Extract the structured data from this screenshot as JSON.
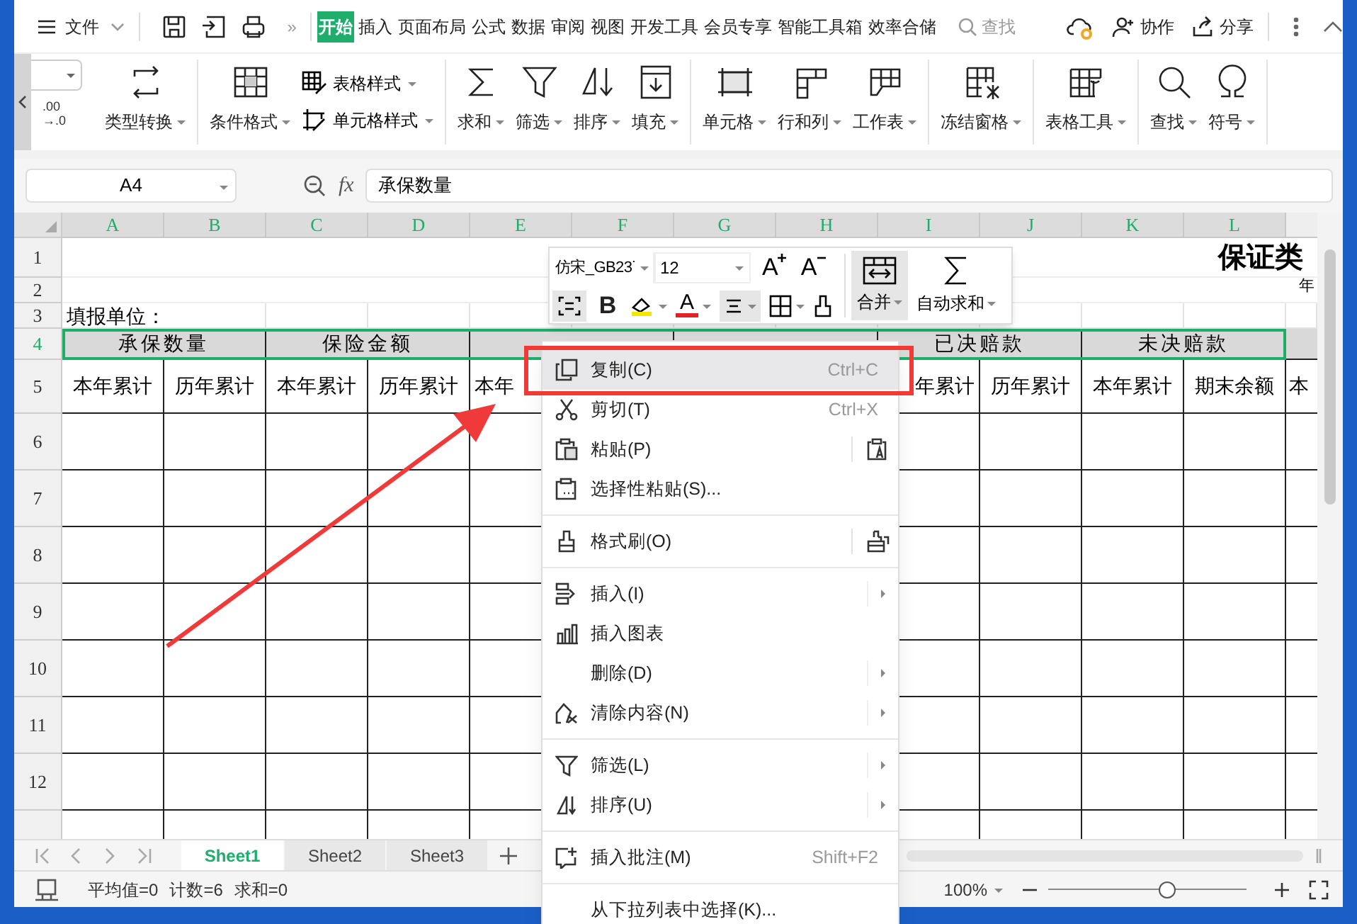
{
  "menu_bar": {
    "file": "文件",
    "more": "»",
    "tabs": [
      {
        "label": "开始",
        "selected": true
      },
      {
        "label": "插入",
        "selected": false
      },
      {
        "label": "页面布局",
        "selected": false
      },
      {
        "label": "公式",
        "selected": false
      },
      {
        "label": "数据",
        "selected": false
      },
      {
        "label": "审阅",
        "selected": false
      },
      {
        "label": "视图",
        "selected": false
      },
      {
        "label": "开发工具",
        "selected": false
      },
      {
        "label": "会员专享",
        "selected": false
      },
      {
        "label": "智能工具箱",
        "selected": false
      },
      {
        "label": "效率合储",
        "selected": false
      }
    ],
    "search_placeholder": "查找",
    "collaborate": "协作",
    "share": "分享"
  },
  "ribbon": {
    "decimal": [
      ".00",
      "→.0"
    ],
    "items": [
      {
        "kind": "large",
        "label": "类型转换"
      },
      {
        "kind": "separator"
      },
      {
        "kind": "large",
        "label": "条件格式"
      },
      {
        "kind": "stack",
        "rows": [
          "表格样式",
          "单元格样式"
        ]
      },
      {
        "kind": "separator"
      },
      {
        "kind": "large",
        "label": "求和"
      },
      {
        "kind": "large",
        "label": "筛选"
      },
      {
        "kind": "large",
        "label": "排序"
      },
      {
        "kind": "large",
        "label": "填充"
      },
      {
        "kind": "separator"
      },
      {
        "kind": "large",
        "label": "单元格"
      },
      {
        "kind": "large",
        "label": "行和列"
      },
      {
        "kind": "large",
        "label": "工作表"
      },
      {
        "kind": "separator"
      },
      {
        "kind": "large",
        "label": "冻结窗格"
      },
      {
        "kind": "separator"
      },
      {
        "kind": "large",
        "label": "表格工具"
      },
      {
        "kind": "separator"
      },
      {
        "kind": "large",
        "label": "查找"
      },
      {
        "kind": "large",
        "label": "符号"
      },
      {
        "kind": "separator"
      }
    ]
  },
  "formula_bar": {
    "cell_ref": "A4",
    "fx": "fx",
    "formula": "承保数量"
  },
  "sheet": {
    "columns": [
      "A",
      "B",
      "C",
      "D",
      "E",
      "F",
      "G",
      "H",
      "I",
      "J",
      "K",
      "L"
    ],
    "rows": [
      "1",
      "2",
      "3",
      "4",
      "5",
      "6",
      "7",
      "8",
      "9",
      "10",
      "11",
      "12"
    ],
    "title": "保证类",
    "row2_text": "年",
    "reporter_label": "填报单位：",
    "row4": {
      "left": [
        "承保数量",
        "保险金额"
      ],
      "right": [
        "已决赔款",
        "未决赔款"
      ]
    },
    "row5": {
      "left": [
        "本年累计",
        "历年累计",
        "本年累计",
        "历年累计",
        "本年"
      ],
      "right": [
        "年累计",
        "历年累计",
        "本年累计",
        "期末余额",
        "本"
      ]
    }
  },
  "mini_toolbar": {
    "font": "仿宋_GB23˙",
    "size": "12",
    "grow": "A",
    "shrink": "A",
    "bold": "B",
    "font_color": "A",
    "merge": "合并",
    "autosum": "自动求和"
  },
  "context_menu": [
    {
      "kind": "item",
      "label": "复制(C)",
      "shortcut": "Ctrl+C",
      "submenu": false,
      "selected": true
    },
    {
      "kind": "item",
      "label": "剪切(T)",
      "shortcut": "Ctrl+X",
      "submenu": false,
      "selected": false
    },
    {
      "kind": "item",
      "label": "粘贴(P)",
      "submenu": false,
      "selected": false
    },
    {
      "kind": "item",
      "label": "选择性粘贴(S)...",
      "submenu": false,
      "selected": false
    },
    {
      "kind": "separator"
    },
    {
      "kind": "item",
      "label": "格式刷(O)",
      "submenu": false,
      "selected": false
    },
    {
      "kind": "separator"
    },
    {
      "kind": "item",
      "label": "插入(I)",
      "submenu": true,
      "selected": false
    },
    {
      "kind": "item",
      "label": "插入图表",
      "submenu": false,
      "selected": false
    },
    {
      "kind": "item",
      "label": "删除(D)",
      "submenu": true,
      "selected": false
    },
    {
      "kind": "item",
      "label": "清除内容(N)",
      "submenu": true,
      "selected": false
    },
    {
      "kind": "separator"
    },
    {
      "kind": "item",
      "label": "筛选(L)",
      "submenu": true,
      "selected": false
    },
    {
      "kind": "item",
      "label": "排序(U)",
      "submenu": true,
      "selected": false
    },
    {
      "kind": "separator"
    },
    {
      "kind": "item",
      "label": "插入批注(M)",
      "shortcut": "Shift+F2",
      "submenu": false,
      "selected": false
    },
    {
      "kind": "separator"
    },
    {
      "kind": "item",
      "label": "从下拉列表中选择(K)...",
      "submenu": false,
      "selected": false
    }
  ],
  "sheet_tabs": [
    {
      "label": "Sheet1",
      "selected": true
    },
    {
      "label": "Sheet2",
      "selected": false
    },
    {
      "label": "Sheet3",
      "selected": false
    }
  ],
  "status_bar": {
    "stats": [
      "平均值=0",
      "计数=6",
      "求和=0"
    ],
    "zoom": "100%",
    "zoom_slider": {
      "level": 0.6
    }
  }
}
